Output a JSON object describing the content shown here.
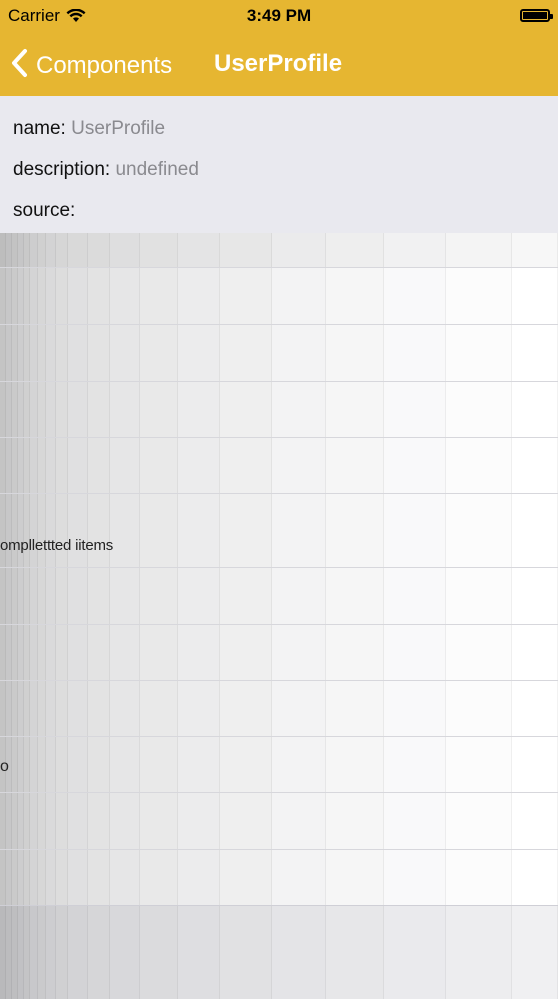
{
  "status": {
    "carrier": "Carrier",
    "time": "3:49 PM",
    "battery_level": 1.0
  },
  "nav": {
    "back_label": "Components",
    "title": "UserProfile"
  },
  "info": {
    "name_label": "name:",
    "name_value": "UserProfile",
    "description_label": "description:",
    "description_value": "undefined",
    "source_label": "source:"
  },
  "preview": {
    "ghost_text_1": "ompllettted iitems",
    "ghost_text_2": "o"
  },
  "colors": {
    "nav_background": "#e6b631",
    "info_background": "#e9e9ef",
    "muted_text": "#8a8a8f"
  }
}
